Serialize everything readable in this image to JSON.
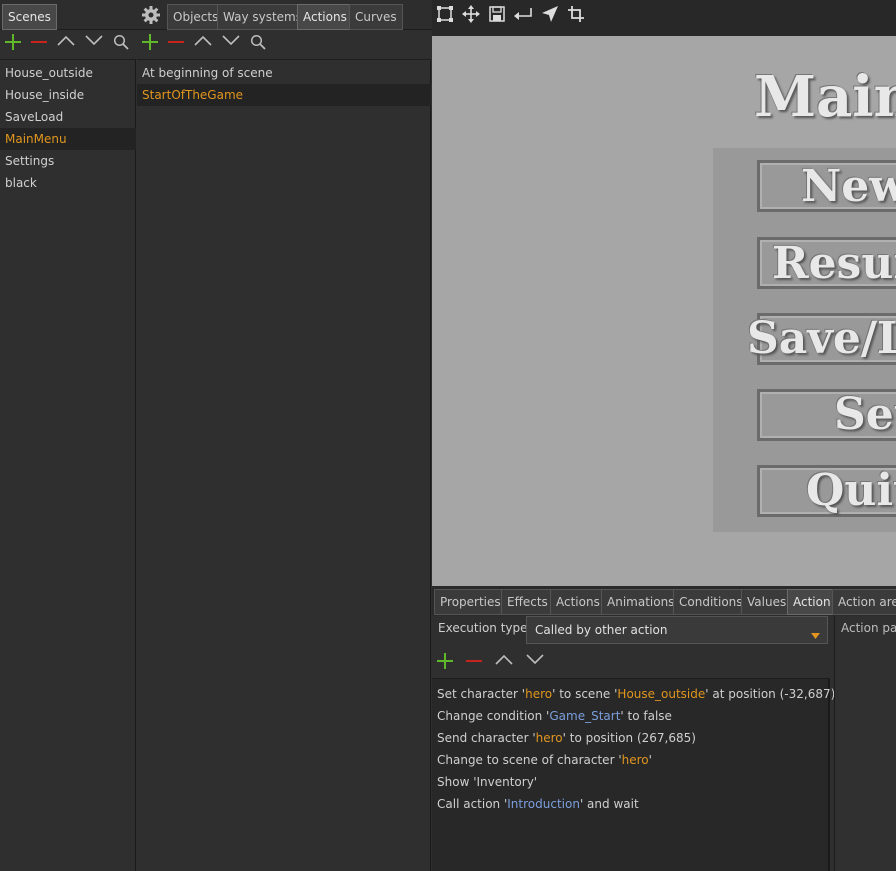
{
  "top_left_tabs": {
    "scenes": "Scenes",
    "objects": "Objects",
    "way_systems": "Way systems",
    "actions": "Actions",
    "curves": "Curves"
  },
  "scenes": [
    "House_outside",
    "House_inside",
    "SaveLoad",
    "MainMenu",
    "Settings",
    "black"
  ],
  "actions_list": [
    "At beginning of scene",
    "StartOfTheGame"
  ],
  "preview": {
    "title": "Main",
    "buttons": [
      "New",
      "Resum",
      "Save/Lo",
      "Set",
      "Quit"
    ]
  },
  "bottom_tabs": {
    "properties": "Properties",
    "effects": "Effects",
    "actions": "Actions",
    "animations": "Animations",
    "conditions": "Conditions",
    "values": "Values",
    "action": "Action",
    "action_area": "Action area"
  },
  "execution": {
    "label": "Execution type",
    "value": "Called by other action"
  },
  "action_params_label": "Action par",
  "action_lines": [
    {
      "parts": [
        {
          "t": "Set character '"
        },
        {
          "t": "hero",
          "c": "o"
        },
        {
          "t": "' to scene '"
        },
        {
          "t": "House_outside",
          "c": "o"
        },
        {
          "t": "' at position (-32,687)"
        }
      ]
    },
    {
      "parts": [
        {
          "t": "Change condition '"
        },
        {
          "t": "Game_Start",
          "c": "b"
        },
        {
          "t": "' to false"
        }
      ]
    },
    {
      "parts": [
        {
          "t": "Send character '"
        },
        {
          "t": "hero",
          "c": "o"
        },
        {
          "t": "' to position (267,685)"
        }
      ]
    },
    {
      "parts": [
        {
          "t": "Change to scene of character '"
        },
        {
          "t": "hero",
          "c": "o"
        },
        {
          "t": "'"
        }
      ]
    },
    {
      "parts": [
        {
          "t": "Show 'Inventory'"
        }
      ]
    },
    {
      "parts": [
        {
          "t": "Call action '"
        },
        {
          "t": "Introduction",
          "c": "b"
        },
        {
          "t": "' and wait"
        }
      ]
    }
  ],
  "colors": {
    "accent_orange": "#e0961e",
    "link_blue": "#7b9fdc",
    "add_green": "#5fb82a",
    "remove_red": "#c8241e"
  }
}
